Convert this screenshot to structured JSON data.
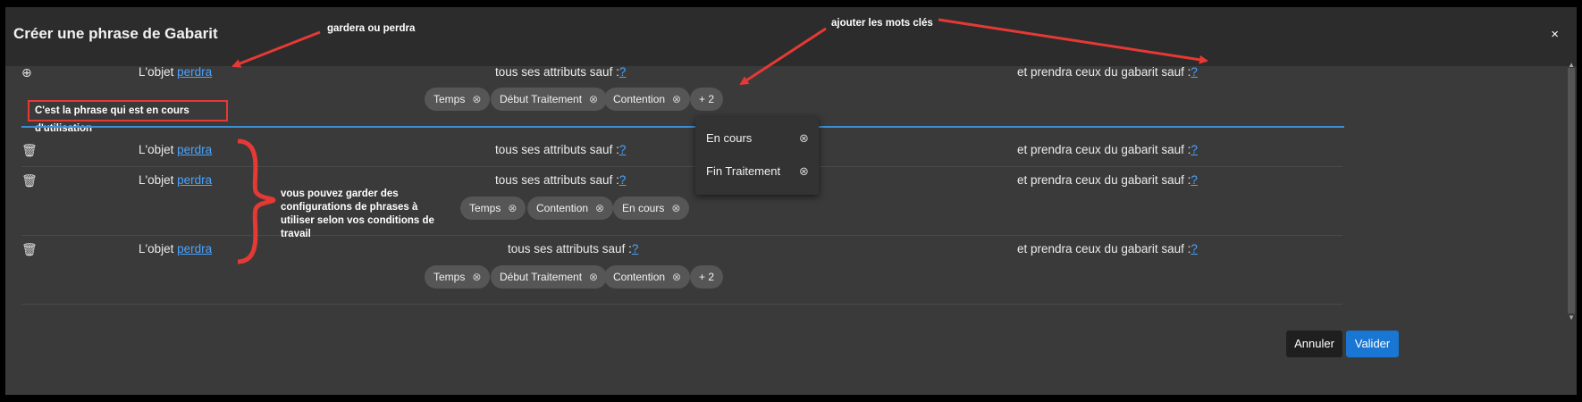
{
  "dialog": {
    "title": "Créer une phrase de Gabarit",
    "close_label": "×",
    "cancel_label": "Annuler",
    "ok_label": "Valider"
  },
  "sentence": {
    "objet": "L'objet",
    "verb": "perdra",
    "attrs": "tous ses attributs sauf :",
    "gabarit": "et prendra ceux du gabarit sauf :",
    "qmark": "?"
  },
  "rows": [
    {
      "icon": "add-circle-icon",
      "chips": [
        "Temps",
        "Début Traitement",
        "Contention"
      ],
      "more": "+ 2"
    },
    {
      "icon": "trash-icon",
      "chips": []
    },
    {
      "icon": "trash-icon",
      "chips": [
        "Temps",
        "Contention",
        "En cours"
      ]
    },
    {
      "icon": "trash-icon",
      "chips": [
        "Temps",
        "Début Traitement",
        "Contention"
      ],
      "more": "+ 2"
    }
  ],
  "dropdown": [
    "En cours",
    "Fin Traitement"
  ],
  "annotations": {
    "current_phrase": "C'est la phrase qui est en cours d'utilisation",
    "keep_or_lose": "gardera ou perdra",
    "add_keywords": "ajouter les mots clés",
    "keep_configs": [
      "vous pouvez garder des",
      "configurations de phrases à",
      "utiliser selon vos conditions de",
      "travail"
    ]
  },
  "colors": {
    "accent": "#1976d2",
    "link": "#4aa3ff",
    "annotation": "#e53935"
  }
}
